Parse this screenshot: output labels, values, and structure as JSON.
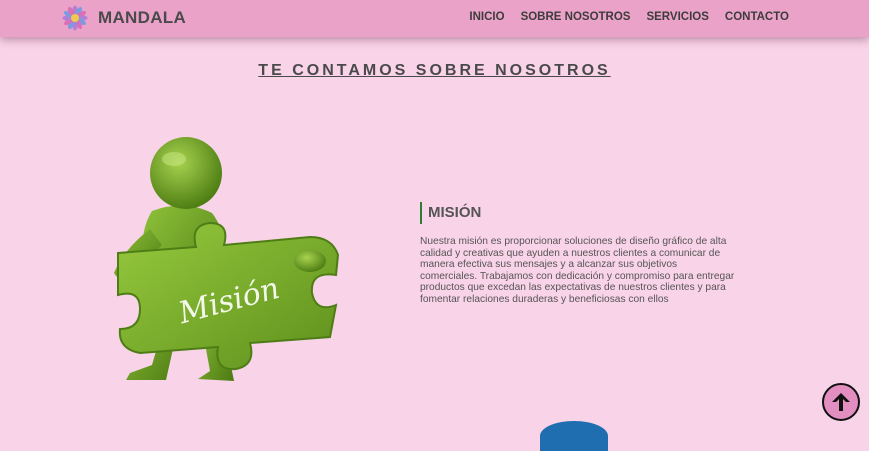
{
  "header": {
    "brand_name": "MANDALA",
    "logo_icon": "mandala-flower-icon",
    "nav": [
      {
        "label": "INICIO"
      },
      {
        "label": "SOBRE NOSOTROS"
      },
      {
        "label": "SERVICIOS"
      },
      {
        "label": "CONTACTO"
      }
    ]
  },
  "about": {
    "title": "TE CONTAMOS SOBRE NOSOTROS",
    "illustration_caption": "Misión",
    "mission": {
      "heading": "MISIÓN",
      "text": "Nuestra misión es proporcionar soluciones de diseño gráfico de alta calidad y creativas que ayuden a nuestros clientes a comunicar de manera efectiva sus mensajes y a alcanzar sus objetivos comerciales. Trabajamos con dedicación y compromiso para entregar productos que excedan las expectativas de nuestros clientes y para fomentar relaciones duraderas y beneficiosas con ellos"
    }
  },
  "back_to_top": {
    "icon": "arrow-up-icon"
  },
  "colors": {
    "navbar": "#eba2c8",
    "background": "#f9d3e8",
    "accent_green": "#2e7d32",
    "puzzle_green": "#76ad2b",
    "back_to_top": "#e38ec1"
  }
}
